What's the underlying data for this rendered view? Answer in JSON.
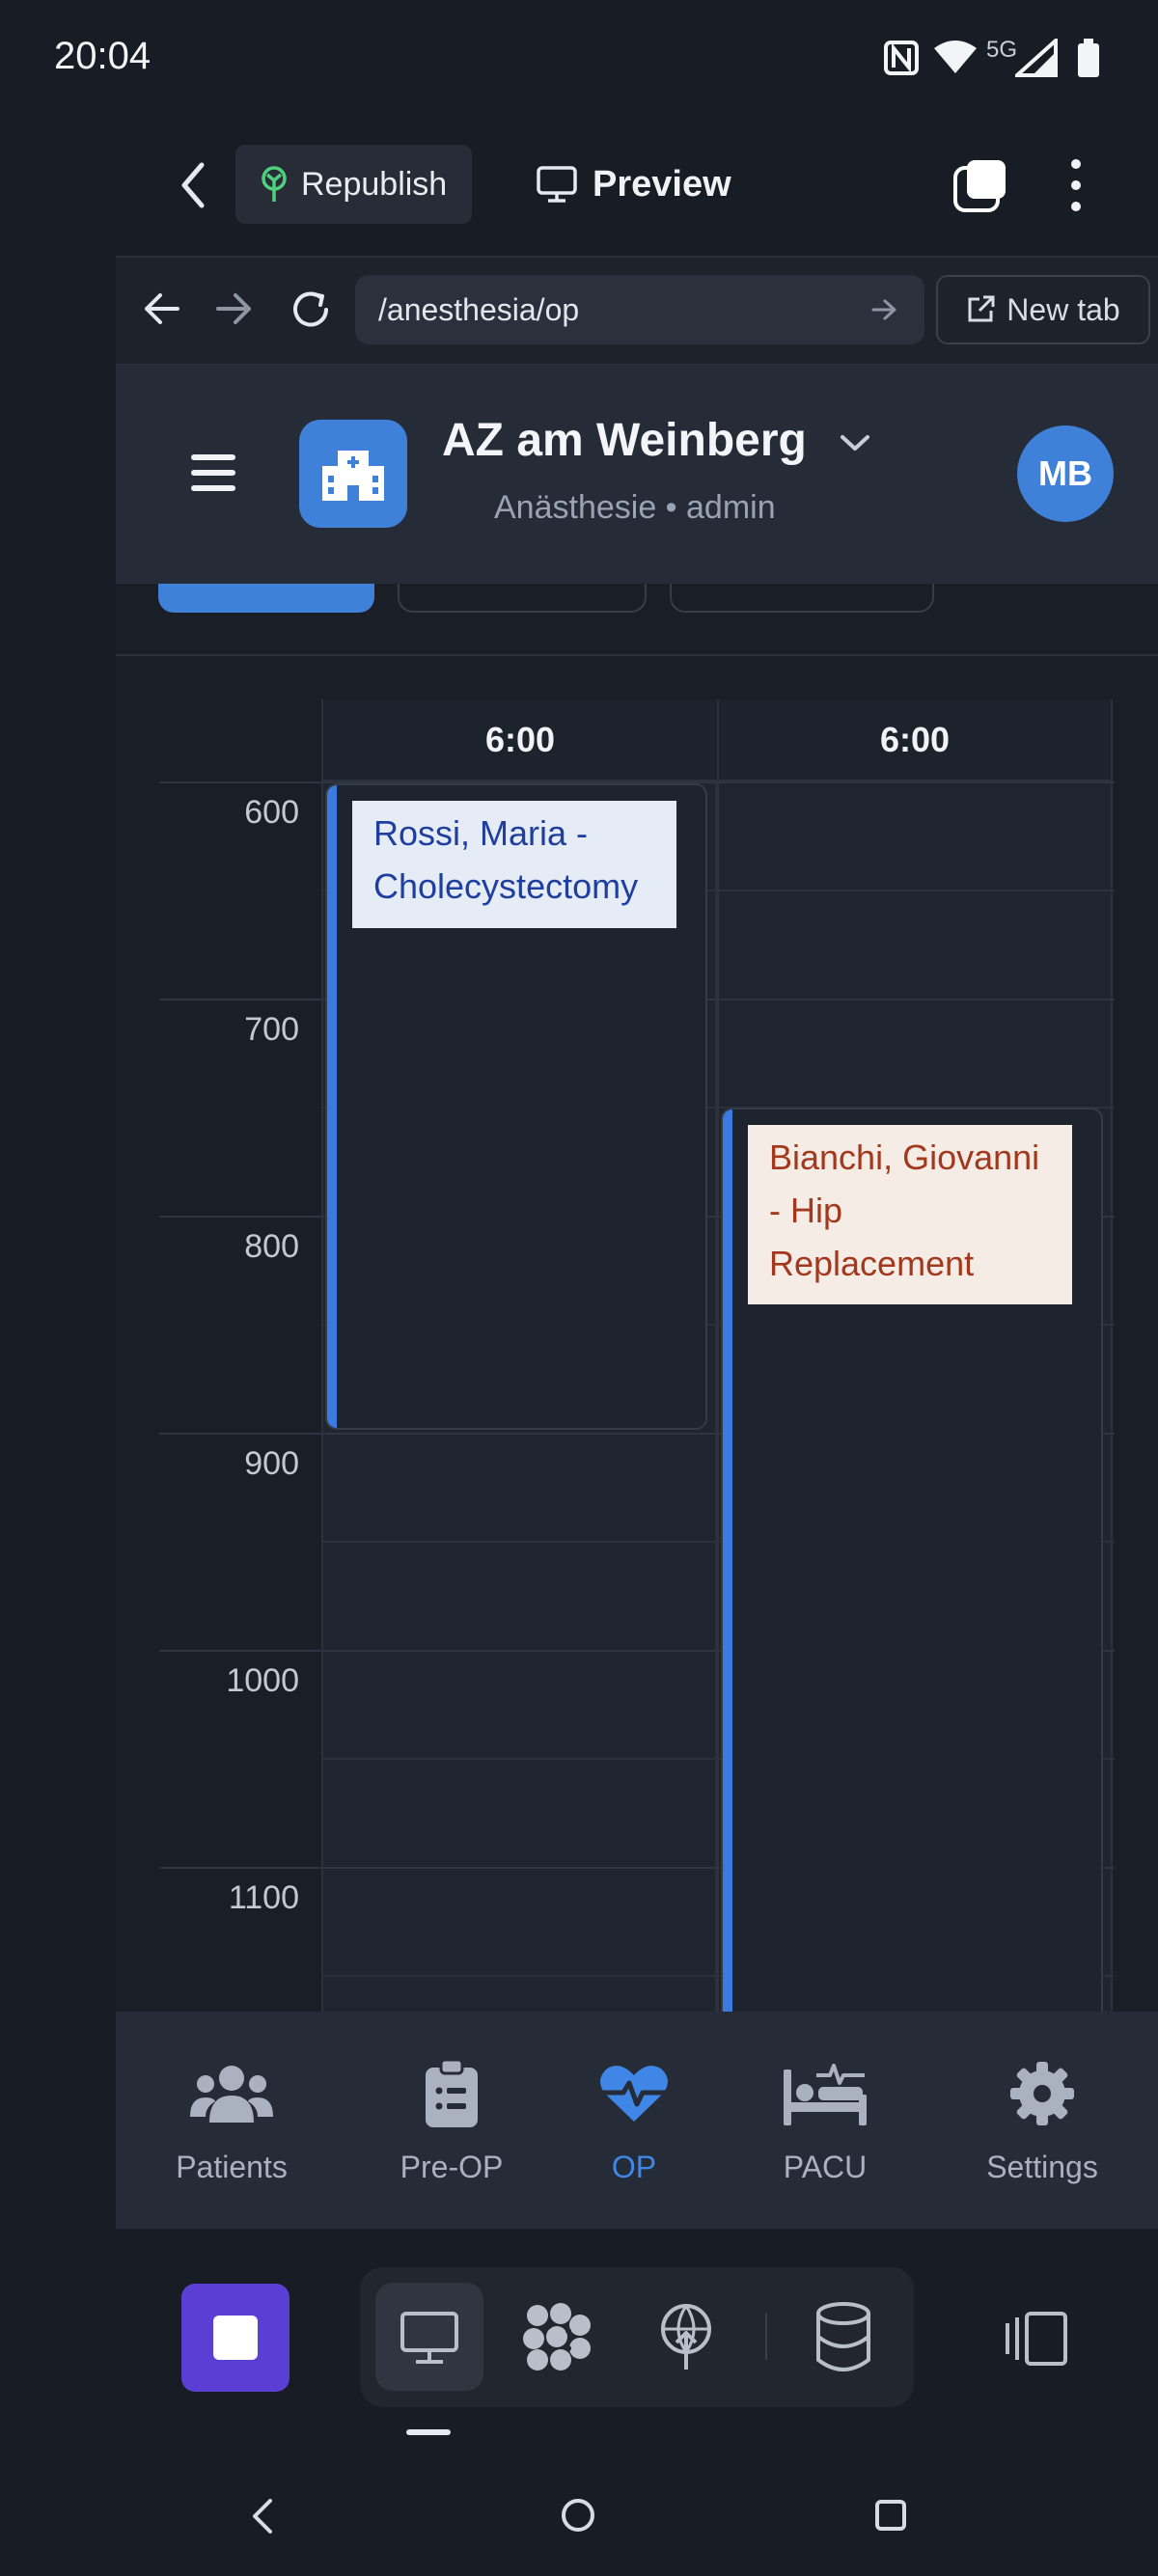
{
  "status_bar": {
    "time": "20:04",
    "network_label": "5G"
  },
  "app_bar": {
    "republish_label": "Republish",
    "preview_label": "Preview"
  },
  "browser": {
    "url": "/anesthesia/op",
    "new_tab_label": "New tab"
  },
  "header": {
    "hospital_name": "AZ am Weinberg",
    "subtitle": "Anästhesie • admin",
    "user_initials": "MB"
  },
  "calendar": {
    "columns": [
      {
        "header": "6:00"
      },
      {
        "header": "6:00"
      }
    ],
    "time_labels": [
      "600",
      "700",
      "800",
      "900",
      "1000",
      "1100"
    ],
    "events": [
      {
        "title": "Rossi, Maria - Cholecystectomy",
        "text_color": "#1f3fa0",
        "label_bg": "#e6ecf6"
      },
      {
        "title": "Bianchi, Giovanni - Hip Replacement",
        "text_color": "#a2381d",
        "label_bg": "#f6ece6"
      }
    ]
  },
  "bottom_nav": {
    "items": [
      {
        "label": "Patients",
        "icon": "users-icon"
      },
      {
        "label": "Pre-OP",
        "icon": "clipboard-list-icon"
      },
      {
        "label": "OP",
        "icon": "heartbeat-icon"
      },
      {
        "label": "PACU",
        "icon": "bed-pulse-icon"
      },
      {
        "label": "Settings",
        "icon": "gear-icon"
      }
    ],
    "active": "OP"
  },
  "colors": {
    "accent": "#3f81d9",
    "active_nav": "#3f86e6",
    "background": "#1a1f27",
    "stop_button": "#5b3fd4"
  }
}
